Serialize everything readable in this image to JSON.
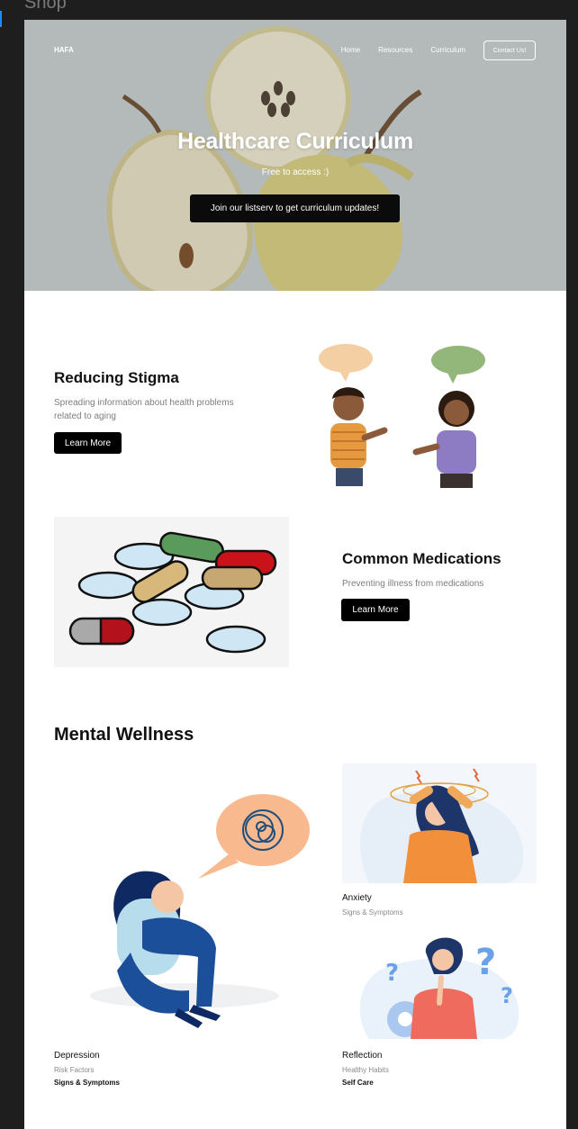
{
  "canvas": {
    "frame_label": "Shop"
  },
  "nav": {
    "brand": "HAFA",
    "links": [
      "Home",
      "Resources",
      "Curriculum"
    ],
    "contact": "Contact Us!"
  },
  "hero": {
    "title": "Healthcare Curriculum",
    "subtitle": "Free to access :)",
    "cta": "Join our listserv to get curriculum updates!"
  },
  "features": [
    {
      "title": "Reducing Stigma",
      "description": "Spreading information about health problems related to aging",
      "button": "Learn More"
    },
    {
      "title": "Common Medications",
      "description": "Preventing illness from medications",
      "button": "Learn More"
    }
  ],
  "mental_wellness": {
    "title": "Mental Wellness",
    "cards": [
      {
        "title": "Depression",
        "subtitle": "Risk Factors",
        "link": "Signs & Symptoms"
      },
      {
        "title": "Anxiety",
        "subtitle": "Signs & Symptoms"
      },
      {
        "title": "Reflection",
        "subtitle": "Healthy Habits",
        "link": "Self Care"
      }
    ]
  },
  "colors": {
    "page_bg": "#1e1e1e",
    "frame_bg": "#ffffff",
    "accent": "#000000",
    "selection": "#1d8cf8"
  }
}
